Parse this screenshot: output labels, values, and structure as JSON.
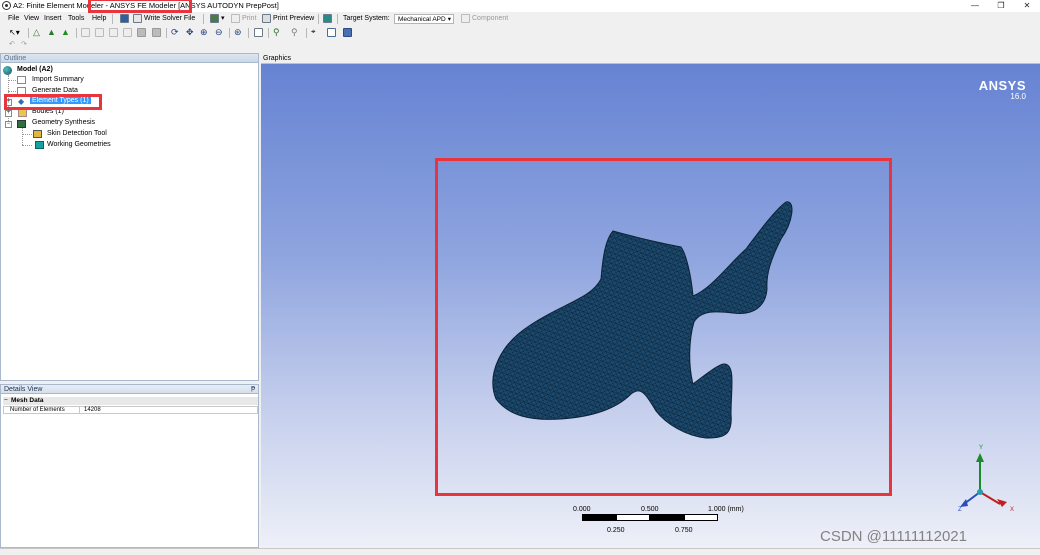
{
  "window": {
    "title": "A2: Finite Element Modeler - ANSYS FE Modeler [ANSYS AUTODYN PrepPost]",
    "controls": [
      "—",
      "❐",
      "✕"
    ]
  },
  "menu": {
    "items": [
      "File",
      "View",
      "Insert",
      "Tools",
      "Help"
    ],
    "write_solver_file": "Write Solver File",
    "print": "Print",
    "print_preview": "Print Preview",
    "target_system_label": "Target System:",
    "target_system_value": "Mechanical APD",
    "component": "Component"
  },
  "outline": {
    "title": "Outline",
    "pin": "ᵽ",
    "root": "Model (A2)",
    "items": [
      {
        "label": "Import Summary",
        "icon": "import-summary-icon"
      },
      {
        "label": "Generate Data",
        "icon": "generate-data-icon"
      },
      {
        "label": "Element Types (1)",
        "icon": "element-types-icon",
        "selected": true
      },
      {
        "label": "Bodies (1)",
        "icon": "bodies-icon"
      },
      {
        "label": "Geometry Synthesis",
        "icon": "geometry-synthesis-icon"
      }
    ],
    "children": [
      {
        "label": "Skin Detection Tool",
        "icon": "skin-detection-icon"
      },
      {
        "label": "Working Geometries",
        "icon": "working-geometries-icon"
      }
    ]
  },
  "details": {
    "title": "Details View",
    "pin": "ᵽ",
    "group": "Mesh Data",
    "rows": [
      {
        "key": "Number of Elements",
        "value": "14208"
      }
    ]
  },
  "graphics": {
    "title": "Graphics",
    "logo": "ANSYS",
    "version": "16.0",
    "scale": {
      "top_labels": [
        "0.000",
        "0.500",
        "1.000 (mm)"
      ],
      "bottom_labels": [
        "0.250",
        "0.750"
      ]
    },
    "triad": {
      "x": "X",
      "y": "Y",
      "z": "Z"
    }
  },
  "colors": {
    "mesh_fill": "#1c4a6e",
    "highlight_box": "#e8343c",
    "selection": "#3399ff"
  },
  "watermark": "CSDN @11111112021"
}
